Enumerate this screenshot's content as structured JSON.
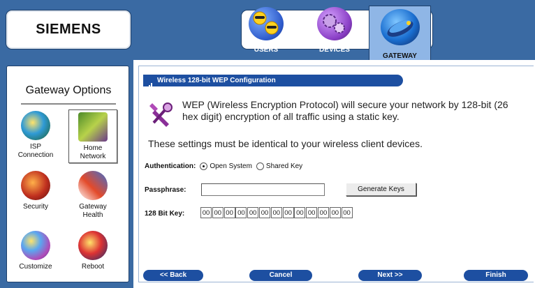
{
  "header": {
    "brand": "SIEMENS",
    "tabs": [
      {
        "label": "USERS",
        "icon": "users-icon"
      },
      {
        "label": "DEVICES",
        "icon": "devices-icon"
      },
      {
        "label": "GATEWAY",
        "icon": "gateway-icon",
        "active": true
      }
    ]
  },
  "sidebar": {
    "title": "Gateway Options",
    "items": [
      {
        "label_line1": "ISP",
        "label_line2": "Connection",
        "icon": "isp-connection-icon"
      },
      {
        "label_line1": "Home",
        "label_line2": "Network",
        "icon": "home-network-icon",
        "selected": true
      },
      {
        "label_line1": "Security",
        "label_line2": "",
        "icon": "security-icon"
      },
      {
        "label_line1": "Gateway",
        "label_line2": "Health",
        "icon": "gateway-health-icon"
      },
      {
        "label_line1": "Customize",
        "label_line2": "",
        "icon": "customize-icon"
      },
      {
        "label_line1": "Reboot",
        "label_line2": "",
        "icon": "reboot-icon"
      }
    ]
  },
  "main": {
    "section_title": "Wireless 128-bit WEP Configuration",
    "description": "WEP (Wireless Encryption Protocol) will secure your network by 128-bit (26 hex digit) encryption of all traffic using a static key.",
    "settings_note": "These settings must be identical to your wireless client devices.",
    "auth": {
      "label": "Authentication:",
      "options": [
        "Open System",
        "Shared Key"
      ],
      "selected": "Open System"
    },
    "passphrase": {
      "label": "Passphrase:",
      "value": ""
    },
    "generate_label": "Generate Keys",
    "key": {
      "label": "128 Bit Key:",
      "values": [
        "00",
        "00",
        "00",
        "00",
        "00",
        "00",
        "00",
        "00",
        "00",
        "00",
        "00",
        "00",
        "00"
      ]
    }
  },
  "nav": {
    "back": "<< Back",
    "cancel": "Cancel",
    "next": "Next >>",
    "finish": "Finish"
  },
  "colors": {
    "header_blue": "#3a6aa3",
    "bar_blue": "#1d4fa1",
    "active_tab": "#8fb6e6"
  }
}
